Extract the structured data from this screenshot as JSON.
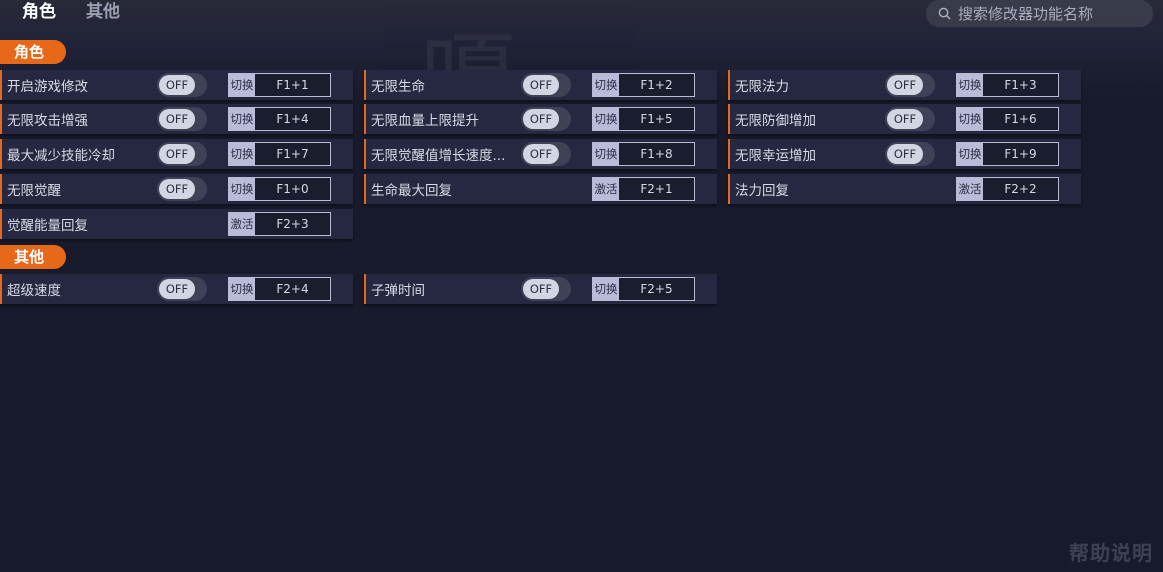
{
  "tabs": [
    {
      "label": "角色"
    },
    {
      "label": "其他"
    }
  ],
  "search": {
    "placeholder": "搜索修改器功能名称"
  },
  "sections": {
    "character": {
      "label": "角色"
    },
    "other": {
      "label": "其他"
    }
  },
  "items": [
    {
      "name": "开启游戏修改",
      "toggle": "OFF",
      "mode": "切换",
      "hotkey": "F1+1"
    },
    {
      "name": "无限生命",
      "toggle": "OFF",
      "mode": "切换",
      "hotkey": "F1+2"
    },
    {
      "name": "无限法力",
      "toggle": "OFF",
      "mode": "切换",
      "hotkey": "F1+3"
    },
    {
      "name": "无限攻击增强",
      "toggle": "OFF",
      "mode": "切换",
      "hotkey": "F1+4"
    },
    {
      "name": "无限血量上限提升",
      "toggle": "OFF",
      "mode": "切换",
      "hotkey": "F1+5"
    },
    {
      "name": "无限防御增加",
      "toggle": "OFF",
      "mode": "切换",
      "hotkey": "F1+6"
    },
    {
      "name": "最大减少技能冷却",
      "toggle": "OFF",
      "mode": "切换",
      "hotkey": "F1+7"
    },
    {
      "name": "无限觉醒值增长速度...",
      "toggle": "OFF",
      "mode": "切换",
      "hotkey": "F1+8"
    },
    {
      "name": "无限幸运增加",
      "toggle": "OFF",
      "mode": "切换",
      "hotkey": "F1+9"
    },
    {
      "name": "无限觉醒",
      "toggle": "OFF",
      "mode": "切换",
      "hotkey": "F1+0"
    },
    {
      "name": "生命最大回复",
      "toggle": null,
      "mode": "激活",
      "hotkey": "F2+1"
    },
    {
      "name": "法力回复",
      "toggle": null,
      "mode": "激活",
      "hotkey": "F2+2"
    },
    {
      "name": "觉醒能量回复",
      "toggle": null,
      "mode": "激活",
      "hotkey": "F2+3"
    },
    {
      "name": "超级速度",
      "toggle": "OFF",
      "mode": "切换",
      "hotkey": "F2+4"
    },
    {
      "name": "子弹时间",
      "toggle": "OFF",
      "mode": "切换",
      "hotkey": "F2+5"
    }
  ],
  "help": {
    "label": "帮助说明"
  },
  "colors": {
    "accent": "#e8681a",
    "background": "#161a2a",
    "row": "#252840"
  },
  "icons": {
    "search": "search-icon"
  }
}
